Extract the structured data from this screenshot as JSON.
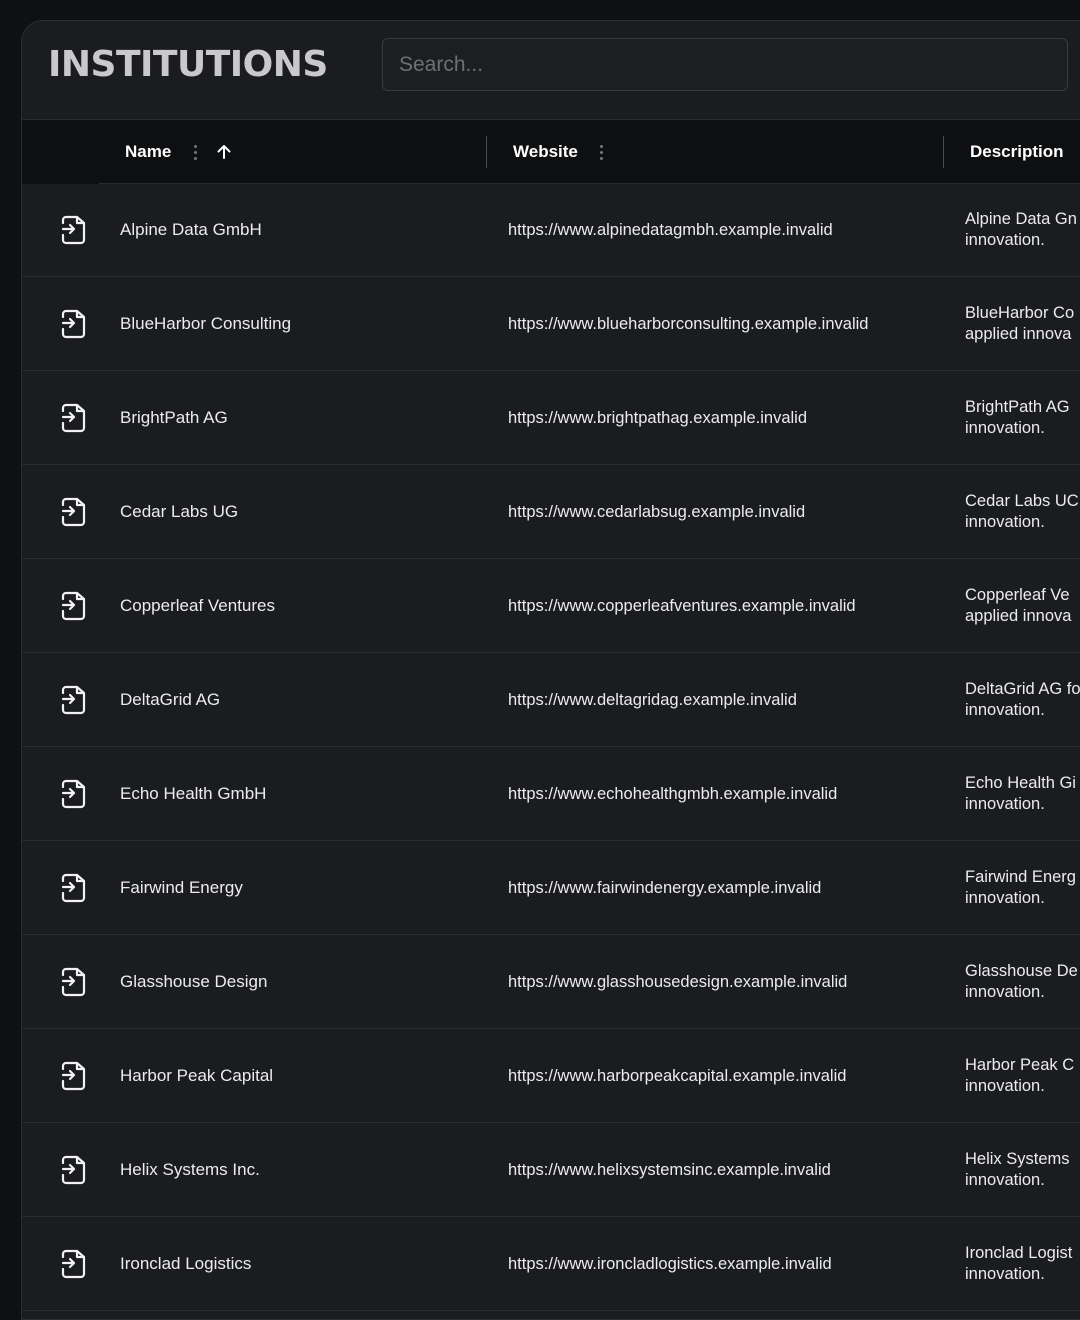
{
  "header": {
    "title": "INSTITUTIONS",
    "search_placeholder": "Search..."
  },
  "columns": {
    "name": "Name",
    "website": "Website",
    "description": "Description"
  },
  "rows": [
    {
      "name": "Alpine Data GmbH",
      "website": "https://www.alpinedatagmbh.example.invalid",
      "desc_line1": "Alpine Data Gn",
      "desc_line2": "innovation."
    },
    {
      "name": "BlueHarbor Consulting",
      "website": "https://www.blueharborconsulting.example.invalid",
      "desc_line1": "BlueHarbor Co",
      "desc_line2": "applied innova"
    },
    {
      "name": "BrightPath AG",
      "website": "https://www.brightpathag.example.invalid",
      "desc_line1": "BrightPath AG",
      "desc_line2": "innovation."
    },
    {
      "name": "Cedar Labs UG",
      "website": "https://www.cedarlabsug.example.invalid",
      "desc_line1": "Cedar Labs UC",
      "desc_line2": "innovation."
    },
    {
      "name": "Copperleaf Ventures",
      "website": "https://www.copperleafventures.example.invalid",
      "desc_line1": "Copperleaf Ve",
      "desc_line2": "applied innova"
    },
    {
      "name": "DeltaGrid AG",
      "website": "https://www.deltagridag.example.invalid",
      "desc_line1": "DeltaGrid AG fo",
      "desc_line2": "innovation."
    },
    {
      "name": "Echo Health GmbH",
      "website": "https://www.echohealthgmbh.example.invalid",
      "desc_line1": "Echo Health Gi",
      "desc_line2": "innovation."
    },
    {
      "name": "Fairwind Energy",
      "website": "https://www.fairwindenergy.example.invalid",
      "desc_line1": "Fairwind Energ",
      "desc_line2": "innovation."
    },
    {
      "name": "Glasshouse Design",
      "website": "https://www.glasshousedesign.example.invalid",
      "desc_line1": "Glasshouse De",
      "desc_line2": "innovation."
    },
    {
      "name": "Harbor Peak Capital",
      "website": "https://www.harborpeakcapital.example.invalid",
      "desc_line1": "Harbor Peak C",
      "desc_line2": "innovation."
    },
    {
      "name": "Helix Systems Inc.",
      "website": "https://www.helixsystemsinc.example.invalid",
      "desc_line1": "Helix Systems",
      "desc_line2": "innovation."
    },
    {
      "name": "Ironclad Logistics",
      "website": "https://www.ironcladlogistics.example.invalid",
      "desc_line1": "Ironclad Logist",
      "desc_line2": "innovation."
    }
  ],
  "icons": {
    "row_action": "file-import-icon",
    "sort": "arrow-up-icon",
    "column_menu": "kebab-menu-icon"
  },
  "colors": {
    "background": "#0f1012",
    "panel": "#1b1c1f",
    "header_row": "#0e0f11",
    "text": "#ececed",
    "title": "#c9c9cb"
  }
}
